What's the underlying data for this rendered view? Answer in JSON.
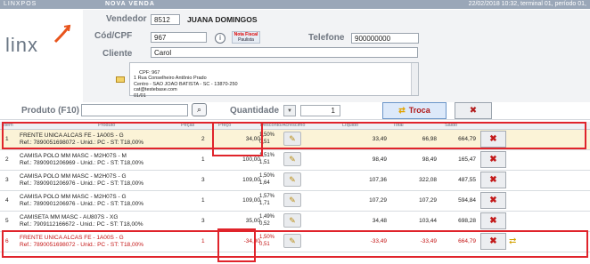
{
  "topbar": {
    "app": "LINXPOS",
    "mode": "NOVA VENDA",
    "status": "22/02/2018 10:32, terminal 01, período 01,"
  },
  "logo": {
    "text": "linx"
  },
  "customer": {
    "vendedor_label": "Vendedor",
    "vendedor_code": "8512",
    "vendedor_name": "JUANA DOMINGOS",
    "cpf_label": "Cód/CPF",
    "cpf_value": "967",
    "info_icon": "i",
    "nfp_line1": "Nota Fiscal",
    "nfp_line2": "Paulista",
    "telefone_label": "Telefone",
    "telefone_value": "900000000",
    "cliente_label": "Cliente",
    "cliente_value": "Carol",
    "address": "CPF: 967\n1 Rua Conselheiro Antônio Prado\nCentro - SAO JOAO BATISTA - SC - 13870-250\ncat@testebase.com\n01/01"
  },
  "entry": {
    "produto_label": "Produto (F10)",
    "produto_value": "",
    "search_icon": "⌕",
    "quantidade_label": "Quantidade",
    "quantidade_value": "1",
    "troca_label": "Troca",
    "troca_icon": "⇄",
    "cancel_icon": "✖"
  },
  "columns": {
    "item": "Item",
    "produto": "Produto",
    "pecas": "Peças",
    "preco": "Preço",
    "desconto": "Desconto/Acréscimo",
    "liquido": "Líquido",
    "total": "Total",
    "saldo": "Saldo"
  },
  "rows": [
    {
      "idx": "1",
      "name": "FRENTE UNICA ALCAS FE - 1A00S - G",
      "ref": "Ref.: 7890051698072 - Unid.: PC - ST: T18,00%",
      "qtd": "2",
      "preco": "34,00",
      "pct": "1,50%",
      "disc": "0,51",
      "liq": "33,49",
      "tot": "66,98",
      "sal": "664,79"
    },
    {
      "idx": "2",
      "name": "CAMISA POLO MM MASC - M2H07S - M",
      "ref": "Ref.: 7890901206969 - Unid.: PC - ST: T18,00%",
      "qtd": "1",
      "preco": "100,00",
      "pct": "1,51%",
      "disc": "1,51",
      "liq": "98,49",
      "tot": "98,49",
      "sal": "165,47"
    },
    {
      "idx": "3",
      "name": "CAMISA POLO MM MASC - M2H07S - G",
      "ref": "Ref.: 7890901206976 - Unid.: PC - ST: T18,00%",
      "qtd": "3",
      "preco": "109,00",
      "pct": "1,50%",
      "disc": "1,64",
      "liq": "107,36",
      "tot": "322,08",
      "sal": "487,55"
    },
    {
      "idx": "4",
      "name": "CAMISA POLO MM MASC - M2H07S - G",
      "ref": "Ref.: 7890901206976 - Unid.: PC - ST: T18,00%",
      "qtd": "1",
      "preco": "109,00",
      "pct": "1,57%",
      "disc": "1,71",
      "liq": "107,29",
      "tot": "107,29",
      "sal": "594,84"
    },
    {
      "idx": "5",
      "name": "CAMISETA MM MASC - AU807S - XG",
      "ref": "Ref.: 7909112166672 - Unid.: PC - ST: T18,00%",
      "qtd": "3",
      "preco": "35,00",
      "pct": "1,49%",
      "disc": "0,52",
      "liq": "34,48",
      "tot": "103,44",
      "sal": "698,28"
    },
    {
      "idx": "6",
      "name": "FRENTE UNICA ALCAS FE - 1A00S - G",
      "ref": "Ref.: 7890051698072 - Unid.: PC - ST: T18,00%",
      "qtd": "1",
      "preco": "-34,00",
      "pct": "1,50%",
      "disc": "0,51",
      "liq": "-33,49",
      "tot": "-33,49",
      "sal": "664,79"
    }
  ],
  "icons": {
    "tag": "tag-icon",
    "delete": "delete-icon",
    "swap": "swap-icon"
  },
  "colors": {
    "highlight": "#e0242b",
    "returned_text": "#c41414",
    "selected_row": "#fbf3d7"
  }
}
